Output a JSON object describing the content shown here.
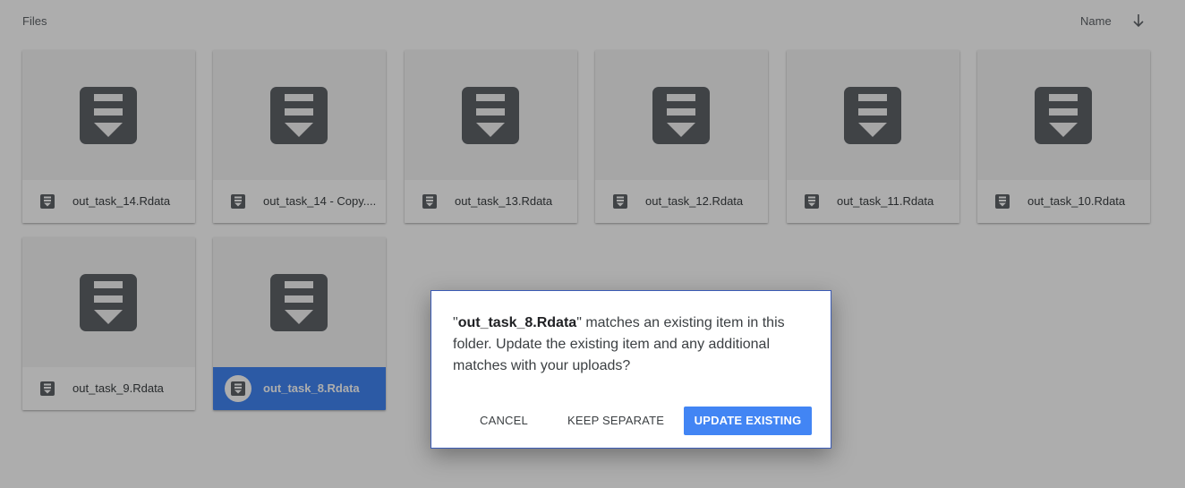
{
  "header": {
    "section_title": "Files",
    "sort_label": "Name",
    "sort_icon": "arrow-down-icon"
  },
  "files": [
    {
      "name": "out_task_14.Rdata",
      "selected": false
    },
    {
      "name": "out_task_14 - Copy....",
      "selected": false
    },
    {
      "name": "out_task_13.Rdata",
      "selected": false
    },
    {
      "name": "out_task_12.Rdata",
      "selected": false
    },
    {
      "name": "out_task_11.Rdata",
      "selected": false
    },
    {
      "name": "out_task_10.Rdata",
      "selected": false
    },
    {
      "name": "out_task_9.Rdata",
      "selected": false
    },
    {
      "name": "out_task_8.Rdata",
      "selected": true
    }
  ],
  "file_icon": "file-download-icon",
  "dialog": {
    "filename": "out_task_8.Rdata",
    "quote_open": "\"",
    "message_rest": "\" matches an existing item in this folder. Update the existing item and any additional matches with your uploads?",
    "cancel_label": "CANCEL",
    "keep_label": "KEEP SEPARATE",
    "update_label": "UPDATE EXISTING"
  },
  "colors": {
    "accent": "#4285f4",
    "icon": "#5f6368"
  }
}
